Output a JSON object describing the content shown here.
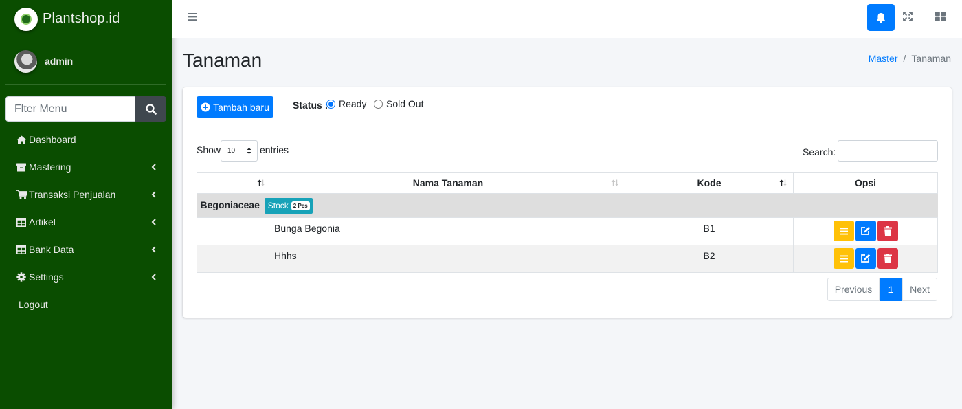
{
  "brand": {
    "name": "Plantshop.id"
  },
  "user": {
    "name": "admin"
  },
  "sidebar": {
    "search_placeholder": "Flter Menu",
    "items": [
      {
        "label": "Dashboard",
        "icon": "home-icon"
      },
      {
        "label": "Mastering",
        "icon": "archive-icon"
      },
      {
        "label": "Transaksi Penjualan",
        "icon": "cart-icon"
      },
      {
        "label": "Artikel",
        "icon": "table-icon"
      },
      {
        "label": "Bank Data",
        "icon": "table-icon"
      },
      {
        "label": "Settings",
        "icon": "gear-icon"
      },
      {
        "label": "Logout",
        "icon": ""
      }
    ]
  },
  "page": {
    "title": "Tanaman"
  },
  "breadcrumb": {
    "parent": "Master",
    "separator": "/",
    "current": "Tanaman"
  },
  "toolbar": {
    "add_label": "Tambah baru",
    "status_label": "Status :",
    "status_options": [
      "Ready",
      "Sold Out"
    ],
    "status_selected": "Ready"
  },
  "table_controls": {
    "show_label": "Show",
    "length_value": "10",
    "entries_label": "entries",
    "search_label": "Search:"
  },
  "table": {
    "columns": [
      "",
      "Nama Tanaman",
      "Kode",
      "Opsi"
    ],
    "group": {
      "name": "Begoniaceae",
      "stock_label": "Stock",
      "stock_count": "2 Pcs"
    },
    "rows": [
      {
        "name": "Bunga Begonia",
        "code": "B1"
      },
      {
        "name": "Hhhs",
        "code": "B2"
      }
    ]
  },
  "pagination": {
    "previous": "Previous",
    "current": "1",
    "next": "Next"
  },
  "colors": {
    "sidebar_bg": "#0a4d00",
    "primary": "#007bff",
    "warning": "#ffc107",
    "danger": "#dc3545",
    "info": "#17a2b8"
  }
}
